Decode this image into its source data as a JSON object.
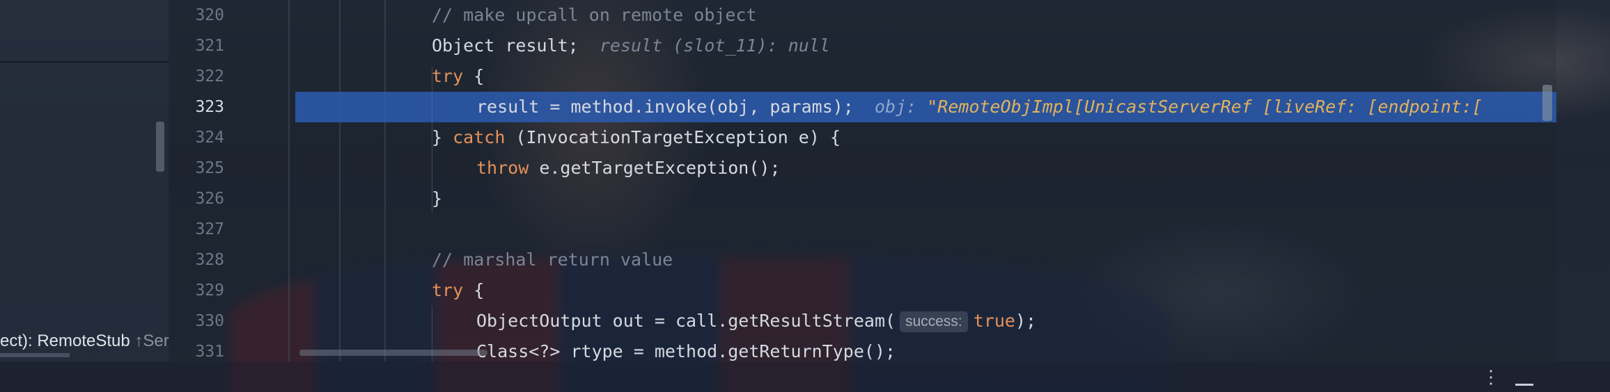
{
  "frames_panel": {
    "frame_label": "ect): RemoteStub",
    "frame_suffix": "↑Ser"
  },
  "editor": {
    "current_line": "323",
    "lines": [
      {
        "number": "320",
        "indent": 0,
        "code": "// make upcall on remote object"
      },
      {
        "number": "321",
        "indent": 0,
        "code": "Object result;",
        "hint": "result (slot_11): null"
      },
      {
        "number": "322",
        "indent": 0,
        "keyword": "try",
        "code": " {"
      },
      {
        "number": "323",
        "indent": 1,
        "code": "result = method.invoke(obj, params);",
        "hint_label": "obj:",
        "hint_value": "\"RemoteObjImpl[UnicastServerRef [liveRef: [endpoint:["
      },
      {
        "number": "324",
        "indent": 0,
        "pre": "} ",
        "keyword": "catch",
        "code": " (InvocationTargetException e) {"
      },
      {
        "number": "325",
        "indent": 1,
        "keyword": "throw",
        "code": " e.getTargetException();"
      },
      {
        "number": "326",
        "indent": 0,
        "code": "}"
      },
      {
        "number": "327",
        "indent": 0,
        "code": ""
      },
      {
        "number": "328",
        "indent": 0,
        "code": "// marshal return value"
      },
      {
        "number": "329",
        "indent": 0,
        "keyword": "try",
        "code": " {"
      },
      {
        "number": "330",
        "indent": 1,
        "code": "ObjectOutput out = call.getResultStream(",
        "param_name": "success:",
        "param_value": "true",
        "tail": ");"
      },
      {
        "number": "331",
        "indent": 1,
        "code": "Class<?> rtype = method.getReturnType();"
      }
    ]
  },
  "icons": {
    "more": "more-options-icon",
    "minimize": "minimize-icon"
  },
  "colors": {
    "keyword": "#e5915a",
    "comment": "#7c8594",
    "current_line_highlight": "#2c5cb0",
    "inline_value": "#e3b25a"
  }
}
